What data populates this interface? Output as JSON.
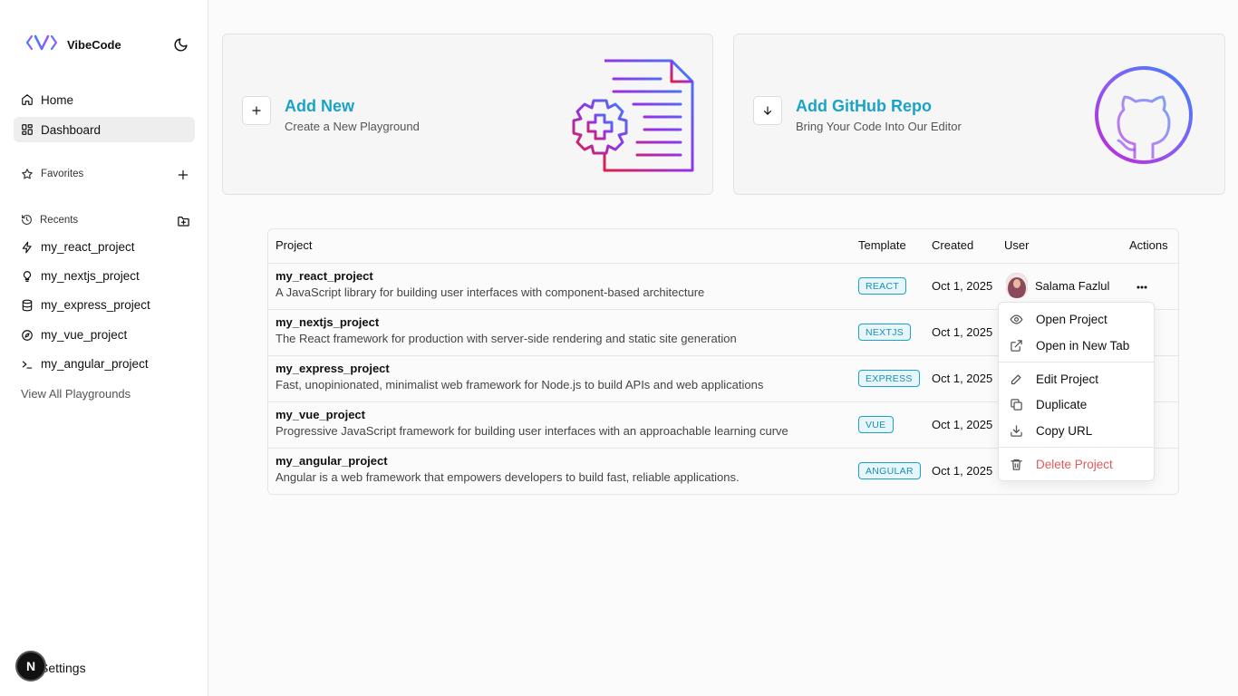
{
  "brand": {
    "name": "VibeCode",
    "logo_icon": "code-bracket-logo",
    "accent_colors": [
      "#3b82f6",
      "#a855f7"
    ]
  },
  "sidebar": {
    "nav": [
      {
        "label": "Home",
        "icon": "home-icon"
      },
      {
        "label": "Dashboard",
        "icon": "dashboard-icon",
        "active": true
      }
    ],
    "favorites_label": "Favorites",
    "recents_label": "Recents",
    "recents": [
      {
        "label": "my_react_project",
        "icon": "zap-icon"
      },
      {
        "label": "my_nextjs_project",
        "icon": "lightbulb-icon"
      },
      {
        "label": "my_express_project",
        "icon": "database-icon"
      },
      {
        "label": "my_vue_project",
        "icon": "compass-icon"
      },
      {
        "label": "my_angular_project",
        "icon": "terminal-icon"
      }
    ],
    "view_all": "View All Playgrounds",
    "settings": "Settings",
    "n_badge": "N"
  },
  "cards": {
    "add_new": {
      "title": "Add New",
      "subtitle": "Create a New Playground"
    },
    "add_github": {
      "title": "Add GitHub Repo",
      "subtitle": "Bring Your Code Into Our Editor"
    }
  },
  "table": {
    "headers": {
      "project": "Project",
      "template": "Template",
      "created": "Created",
      "user": "User",
      "actions": "Actions"
    },
    "rows": [
      {
        "name": "my_react_project",
        "desc": "A JavaScript library for building user interfaces with component-based architecture",
        "template": "REACT",
        "created": "Oct 1, 2025",
        "user": "Salama Fazlul"
      },
      {
        "name": "my_nextjs_project",
        "desc": "The React framework for production with server-side rendering and static site generation",
        "template": "NEXTJS",
        "created": "Oct 1, 2025",
        "user": ""
      },
      {
        "name": "my_express_project",
        "desc": "Fast, unopinionated, minimalist web framework for Node.js to build APIs and web applications",
        "template": "EXPRESS",
        "created": "Oct 1, 2025",
        "user": ""
      },
      {
        "name": "my_vue_project",
        "desc": "Progressive JavaScript framework for building user interfaces with an approachable learning curve",
        "template": "VUE",
        "created": "Oct 1, 2025",
        "user": ""
      },
      {
        "name": "my_angular_project",
        "desc": "Angular is a web framework that empowers developers to build fast, reliable applications.",
        "template": "ANGULAR",
        "created": "Oct 1, 2025",
        "user": ""
      }
    ]
  },
  "menu": {
    "open_project": "Open Project",
    "open_new_tab": "Open in New Tab",
    "edit_project": "Edit Project",
    "duplicate": "Duplicate",
    "copy_url": "Copy URL",
    "delete_project": "Delete Project"
  }
}
